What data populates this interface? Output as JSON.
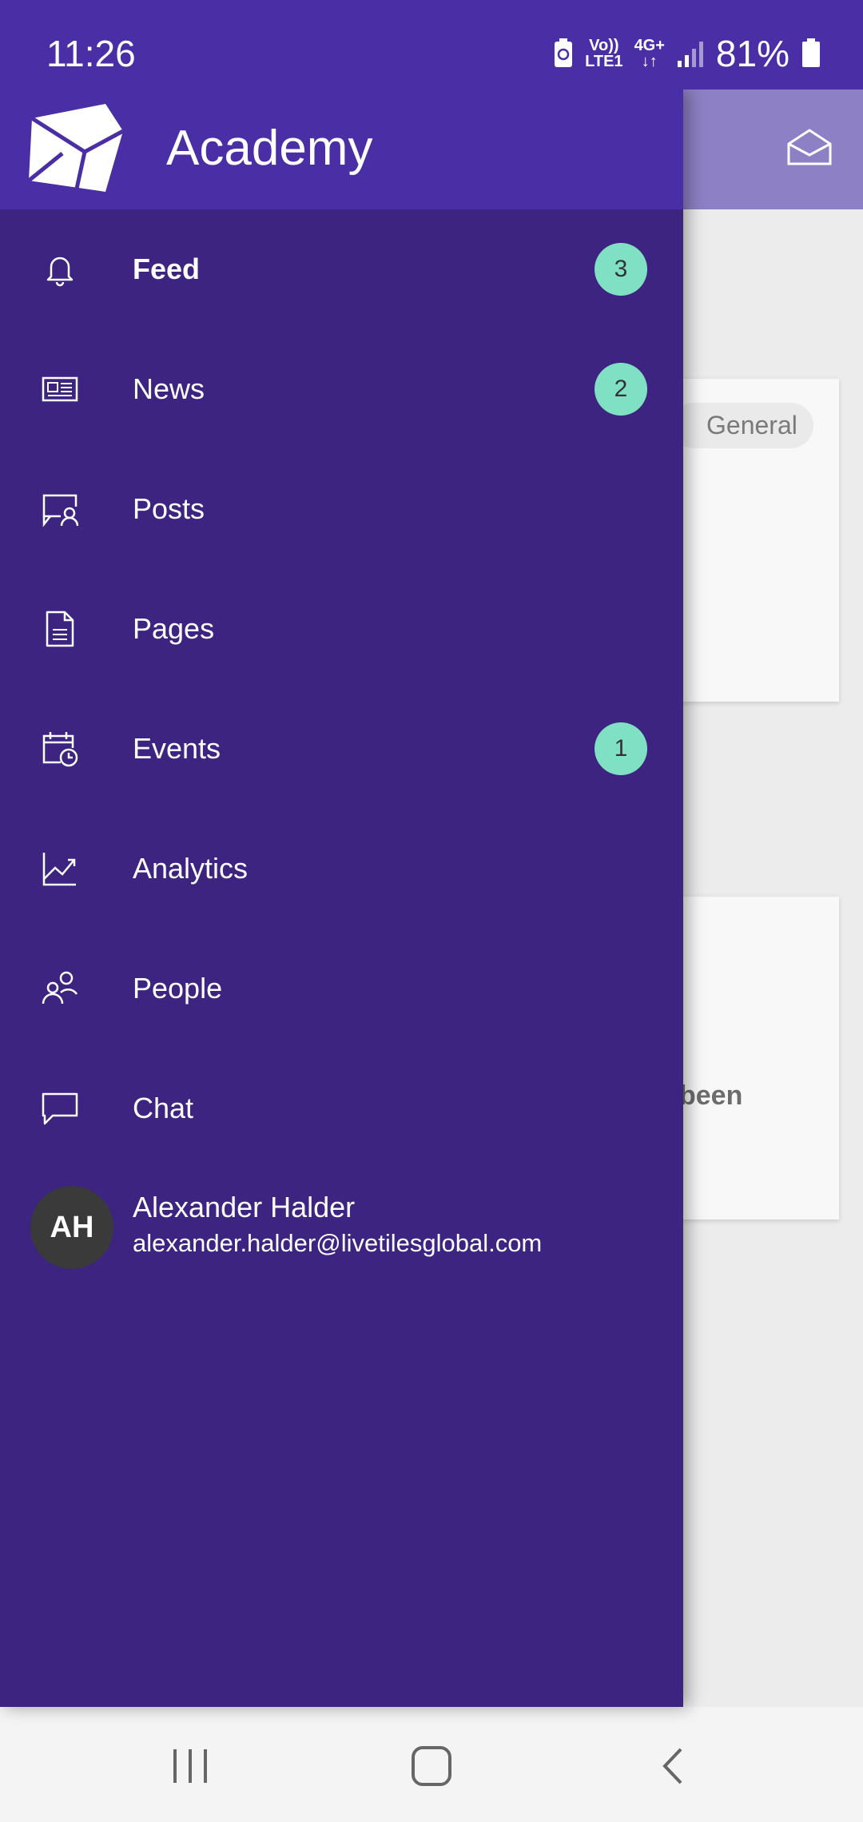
{
  "status_bar": {
    "time": "11:26",
    "network_top": "Vo))",
    "network_bottom": "LTE1",
    "data_type": "4G+",
    "battery_percent": "81%"
  },
  "background_app": {
    "chip_label": "General",
    "partial_text": "been"
  },
  "drawer": {
    "title": "Academy",
    "items": [
      {
        "label": "Feed",
        "icon": "bell-icon",
        "badge": "3"
      },
      {
        "label": "News",
        "icon": "newspaper-icon",
        "badge": "2"
      },
      {
        "label": "Posts",
        "icon": "chat-person-icon",
        "badge": ""
      },
      {
        "label": "Pages",
        "icon": "document-icon",
        "badge": ""
      },
      {
        "label": "Events",
        "icon": "calendar-clock-icon",
        "badge": "1"
      },
      {
        "label": "Analytics",
        "icon": "chart-line-icon",
        "badge": ""
      },
      {
        "label": "People",
        "icon": "people-icon",
        "badge": ""
      },
      {
        "label": "Chat",
        "icon": "speech-bubble-icon",
        "badge": ""
      }
    ],
    "user": {
      "initials": "AH",
      "name": "Alexander Halder",
      "email": "alexander.halder@livetilesglobal.com"
    }
  },
  "colors": {
    "drawer_bg": "#3c2480",
    "header_bg": "#4a2ea6",
    "badge_bg": "#7fe0c4"
  }
}
